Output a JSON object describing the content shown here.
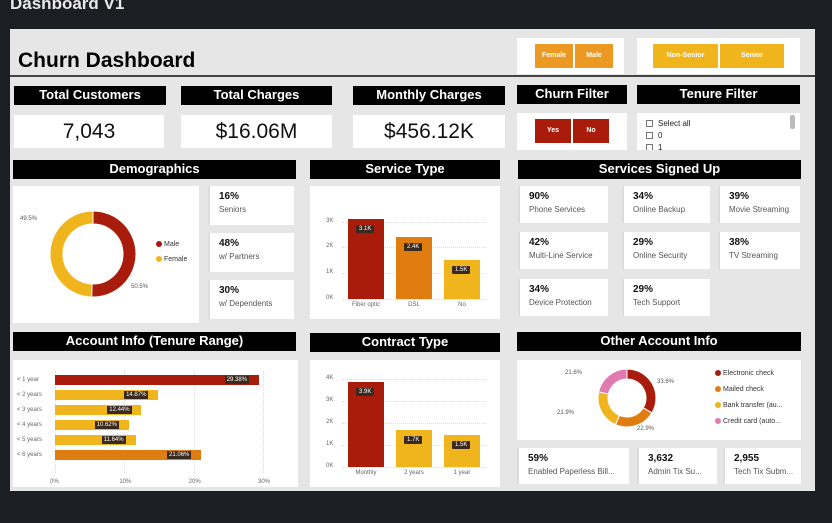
{
  "window": {
    "title": "Dashboard V1"
  },
  "header": {
    "title": "Churn Dashboard"
  },
  "filters": {
    "gender": [
      "Female",
      "Male"
    ],
    "senior": [
      "Non-Senior",
      "Senior"
    ],
    "churn_title": "Churn Filter",
    "churn": [
      "Yes",
      "No"
    ],
    "tenure_title": "Tenure Filter",
    "tenure_options": [
      "Select all",
      "0",
      "1"
    ]
  },
  "kpis": [
    {
      "title": "Total Customers",
      "value": "7,043"
    },
    {
      "title": "Total Charges",
      "value": "$16.06M"
    },
    {
      "title": "Monthly Charges",
      "value": "$456.12K"
    }
  ],
  "sections": {
    "demographics": "Demographics",
    "service_type": "Service Type",
    "services_signed": "Services Signed Up",
    "account_info": "Account Info (Tenure Range)",
    "contract_type": "Contract Type",
    "other_account": "Other Account Info"
  },
  "demographics": {
    "pie_labels": {
      "left": "49.5%",
      "right": "50.5%"
    },
    "legend": [
      "Male",
      "Female"
    ],
    "cards": [
      {
        "value": "16%",
        "label": "Seniors"
      },
      {
        "value": "48%",
        "label": "w/ Partners"
      },
      {
        "value": "30%",
        "label": "w/ Dependents"
      }
    ]
  },
  "services": [
    {
      "value": "90%",
      "label": "Phone Services"
    },
    {
      "value": "34%",
      "label": "Online Backup"
    },
    {
      "value": "39%",
      "label": "Movie Streaming"
    },
    {
      "value": "42%",
      "label": "Multi-Line Service"
    },
    {
      "value": "29%",
      "label": "Online Security"
    },
    {
      "value": "38%",
      "label": "TV Streaming"
    },
    {
      "value": "34%",
      "label": "Device Protection"
    },
    {
      "value": "29%",
      "label": "Tech Support"
    }
  ],
  "other_cards": [
    {
      "value": "59%",
      "label": "Enabled Paperless Bill..."
    },
    {
      "value": "3,632",
      "label": "Admin Tix Su..."
    },
    {
      "value": "2,955",
      "label": "Tech Tix Subm..."
    }
  ],
  "payment": {
    "legend": [
      "Electronic check",
      "Mailed check",
      "Bank transfer (au...",
      "Credit card (auto..."
    ],
    "labels": [
      "21.6%",
      "33.6%",
      "21.9%",
      "22.9%"
    ]
  },
  "colors": {
    "red": "#a91c0c",
    "orange": "#e07d10",
    "yellow": "#f0b51d",
    "pink": "#e07ab0"
  },
  "chart_data": [
    {
      "type": "pie",
      "categories": [
        "Male",
        "Female"
      ],
      "values": [
        50.5,
        49.5
      ],
      "title": "Demographics"
    },
    {
      "type": "bar",
      "title": "Service Type",
      "categories": [
        "Fiber optic",
        "DSL",
        "No"
      ],
      "values": [
        3096,
        2421,
        1526
      ],
      "data_labels": [
        "3.1K",
        "2.4K",
        "1.5K"
      ],
      "yticks": [
        "0K",
        "1K",
        "2K",
        "3K"
      ],
      "ylim": [
        0,
        3300
      ]
    },
    {
      "type": "bar",
      "orientation": "horizontal",
      "title": "Account Info (Tenure Range)",
      "categories": [
        "< 1 year",
        "< 2 years",
        "< 3 years",
        "< 4 years",
        "< 5 years",
        "< 6 years"
      ],
      "values": [
        29.38,
        14.87,
        12.44,
        10.62,
        11.64,
        21.06
      ],
      "data_labels": [
        "29.38%",
        "14.87%",
        "12.44%",
        "10.62%",
        "11.64%",
        "21.06%"
      ],
      "xticks": [
        "0%",
        "10%",
        "20%",
        "30%"
      ],
      "xlim": [
        0,
        30
      ]
    },
    {
      "type": "bar",
      "title": "Contract Type",
      "categories": [
        "Monthly",
        "2 years",
        "1 year"
      ],
      "values": [
        3875,
        1695,
        1473
      ],
      "data_labels": [
        "3.9K",
        "1.7K",
        "1.5K"
      ],
      "yticks": [
        "0K",
        "1K",
        "2K",
        "3K",
        "4K"
      ],
      "ylim": [
        0,
        4000
      ]
    },
    {
      "type": "pie",
      "title": "Other Account Info",
      "categories": [
        "Electronic check",
        "Mailed check",
        "Bank transfer (au...",
        "Credit card (auto..."
      ],
      "values": [
        33.6,
        22.9,
        21.9,
        21.6
      ]
    }
  ]
}
